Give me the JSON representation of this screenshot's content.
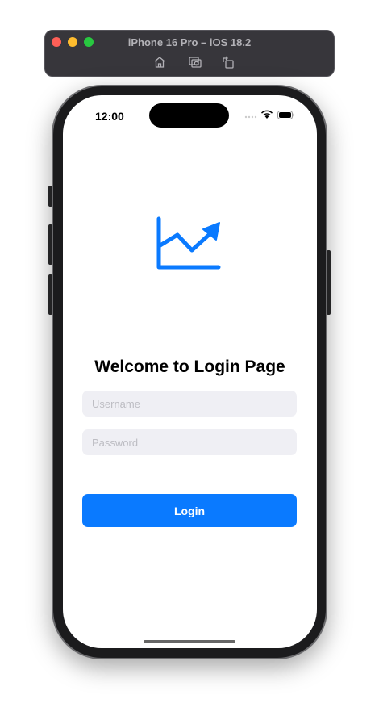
{
  "window": {
    "title": "iPhone 16 Pro – iOS 18.2",
    "toolbar_icons": [
      "home-icon",
      "screenshot-icon",
      "rotate-icon"
    ]
  },
  "status_bar": {
    "time": "12:00"
  },
  "app": {
    "icon": "chart-line-uptrend-icon",
    "accent": "#0a7aff",
    "title": "Welcome to Login Page",
    "username": {
      "value": "",
      "placeholder": "Username"
    },
    "password": {
      "value": "",
      "placeholder": "Password"
    },
    "login_label": "Login"
  }
}
